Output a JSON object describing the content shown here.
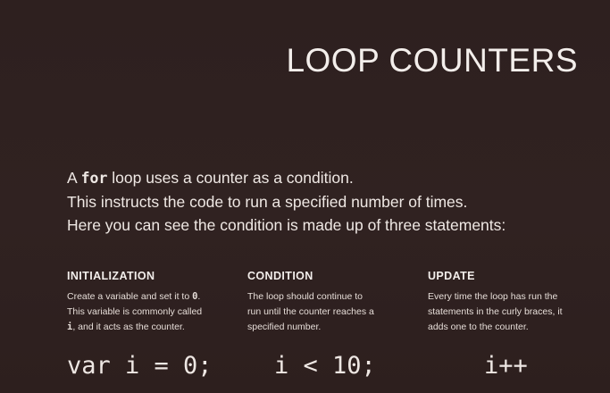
{
  "title": "LOOP COUNTERS",
  "intro": {
    "line1_prefix": "A ",
    "line1_code": "for",
    "line1_suffix": " loop uses a counter as a condition.",
    "line2": "This instructs the code to run a specified number of times.",
    "line3": "Here you can see the condition is made up of three statements:"
  },
  "columns": [
    {
      "heading": "INITIALIZATION",
      "line1_prefix": "Create a variable and set it to ",
      "line1_code": "0",
      "line1_suffix": ".",
      "line2": "This variable is commonly called",
      "line3_code": "i",
      "line3_suffix": ", and it acts as the counter.",
      "code": "var i = 0;"
    },
    {
      "heading": "CONDITION",
      "line1": "The loop should continue to",
      "line2": "run until the counter reaches a",
      "line3": "specified number.",
      "code": "i < 10;"
    },
    {
      "heading": "UPDATE",
      "line1": "Every time the loop has run the",
      "line2": "statements in the curly braces, it",
      "line3": "adds one to the counter.",
      "code": "i++"
    }
  ]
}
